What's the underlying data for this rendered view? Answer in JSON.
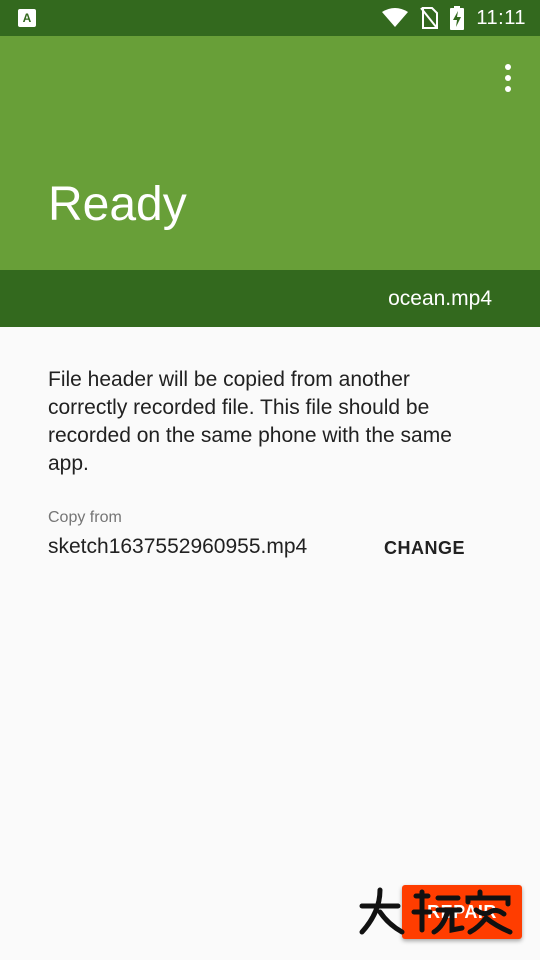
{
  "status_bar": {
    "app_icon_letter": "A",
    "time": "11:11",
    "icons": [
      "wifi-icon",
      "no-sim-icon",
      "battery-charging-icon"
    ]
  },
  "app_bar": {
    "title": "Ready",
    "menu_icon": "more-vert-icon",
    "background_color": "#689f38"
  },
  "file_band": {
    "file_name": "ocean.mp4",
    "background_color": "#33691e"
  },
  "content": {
    "description": "File header will be copied from another correctly recorded file. This file should be recorded on the same phone with the same app.",
    "copy_from_label": "Copy from",
    "copy_from_file": "sketch1637552960955.mp4",
    "change_label": "CHANGE"
  },
  "repair": {
    "label": "REPAIR",
    "background_color": "#ff3d00"
  },
  "watermark": {
    "text": "大玩家"
  }
}
